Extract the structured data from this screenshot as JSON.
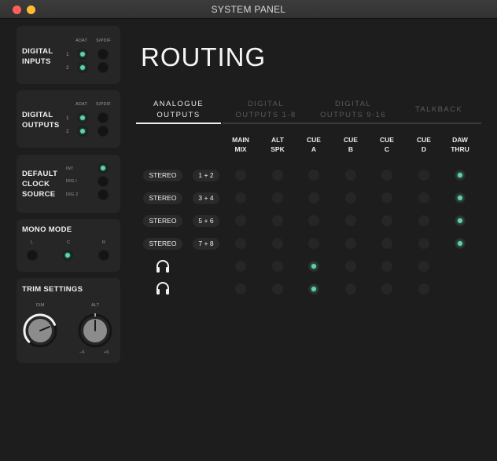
{
  "window": {
    "title": "SYSTEM PANEL"
  },
  "colors": {
    "accent": "#5fd3a6",
    "background": "#1d1d1d",
    "panel": "#262626"
  },
  "digital_inputs": {
    "title_line1": "DIGITAL",
    "title_line2": "INPUTS",
    "col_labels": [
      "ADAT",
      "S/PDIF"
    ],
    "rows": [
      {
        "label": "1",
        "adat": true,
        "spdif": false
      },
      {
        "label": "2",
        "adat": true,
        "spdif": false
      }
    ]
  },
  "digital_outputs": {
    "title_line1": "DIGITAL",
    "title_line2": "OUTPUTS",
    "col_labels": [
      "ADAT",
      "S/PDIF"
    ],
    "rows": [
      {
        "label": "1",
        "adat": true,
        "spdif": false
      },
      {
        "label": "2",
        "adat": true,
        "spdif": false
      }
    ]
  },
  "clock_source": {
    "title_lines": [
      "DEFAULT",
      "CLOCK",
      "SOURCE"
    ],
    "options": [
      {
        "label": "INT",
        "selected": true
      },
      {
        "label": "DIG I",
        "selected": false
      },
      {
        "label": "DIG 2",
        "selected": false
      }
    ]
  },
  "mono_mode": {
    "title": "MONO MODE",
    "options": [
      {
        "label": "L",
        "selected": false
      },
      {
        "label": "C",
        "selected": true
      },
      {
        "label": "R",
        "selected": false
      }
    ]
  },
  "trim_settings": {
    "title": "TRIM SETTINGS",
    "knobs": [
      {
        "label": "DIM",
        "value_fraction": 0.75
      },
      {
        "label": "ALT",
        "value_fraction": 0.5
      }
    ],
    "range_min": "−6",
    "range_max": "+6"
  },
  "main": {
    "heading": "ROUTING"
  },
  "tabs": [
    {
      "line1": "ANALOGUE",
      "line2": "OUTPUTS",
      "active": true
    },
    {
      "line1": "DIGITAL",
      "line2": "OUTPUTS 1-8",
      "active": false
    },
    {
      "line1": "DIGITAL",
      "line2": "OUTPUTS 9-16",
      "active": false
    },
    {
      "line1": "TALKBACK",
      "line2": "",
      "active": false
    }
  ],
  "matrix": {
    "columns": [
      {
        "line1": "MAIN",
        "line2": "MIX"
      },
      {
        "line1": "ALT",
        "line2": "SPK"
      },
      {
        "line1": "CUE",
        "line2": "A"
      },
      {
        "line1": "CUE",
        "line2": "B"
      },
      {
        "line1": "CUE",
        "line2": "C"
      },
      {
        "line1": "CUE",
        "line2": "D"
      },
      {
        "line1": "DAW",
        "line2": "THRU"
      }
    ],
    "rows": [
      {
        "type": "stereo",
        "mode": "STEREO",
        "channels": "1 + 2",
        "active": [
          false,
          false,
          false,
          false,
          false,
          false,
          true
        ]
      },
      {
        "type": "stereo",
        "mode": "STEREO",
        "channels": "3 + 4",
        "active": [
          false,
          false,
          false,
          false,
          false,
          false,
          true
        ]
      },
      {
        "type": "stereo",
        "mode": "STEREO",
        "channels": "5 + 6",
        "active": [
          false,
          false,
          false,
          false,
          false,
          false,
          true
        ]
      },
      {
        "type": "stereo",
        "mode": "STEREO",
        "channels": "7 + 8",
        "active": [
          false,
          false,
          false,
          false,
          false,
          false,
          true
        ]
      },
      {
        "type": "headphones",
        "icon": "headphones-icon",
        "active": [
          false,
          false,
          true,
          false,
          false,
          false
        ]
      },
      {
        "type": "headphones",
        "icon": "headphones-icon",
        "active": [
          false,
          false,
          true,
          false,
          false,
          false
        ]
      }
    ]
  }
}
